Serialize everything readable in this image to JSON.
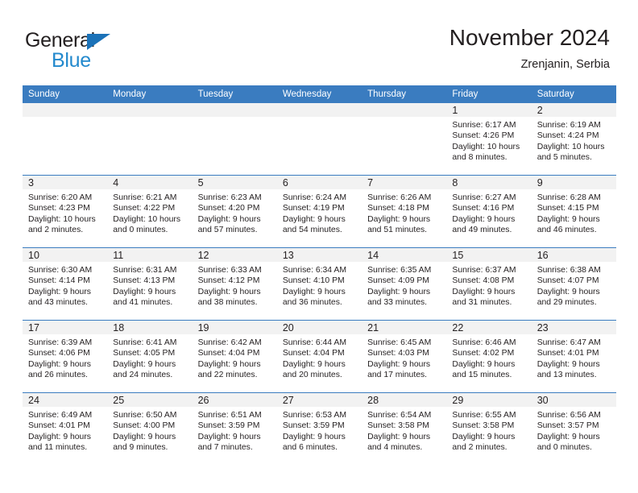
{
  "brand": {
    "name_part1": "General",
    "name_part2": "Blue",
    "triangle_icon": "triangle-icon",
    "color_dark": "#231f20",
    "color_blue": "#2389cd",
    "color_triangle": "#1b72b8"
  },
  "header": {
    "title": "November 2024",
    "subtitle": "Zrenjanin, Serbia"
  },
  "theme": {
    "header_row_bg": "#3a7cc0",
    "daynum_bg": "#f2f2f2",
    "grid_line": "#3a7cc0",
    "text": "#231f20"
  },
  "weekdays": [
    "Sunday",
    "Monday",
    "Tuesday",
    "Wednesday",
    "Thursday",
    "Friday",
    "Saturday"
  ],
  "weeks": [
    [
      {
        "day": "",
        "sunrise": "",
        "sunset": "",
        "daylight_line1": "",
        "daylight_line2": "",
        "empty": true
      },
      {
        "day": "",
        "sunrise": "",
        "sunset": "",
        "daylight_line1": "",
        "daylight_line2": "",
        "empty": true
      },
      {
        "day": "",
        "sunrise": "",
        "sunset": "",
        "daylight_line1": "",
        "daylight_line2": "",
        "empty": true
      },
      {
        "day": "",
        "sunrise": "",
        "sunset": "",
        "daylight_line1": "",
        "daylight_line2": "",
        "empty": true
      },
      {
        "day": "",
        "sunrise": "",
        "sunset": "",
        "daylight_line1": "",
        "daylight_line2": "",
        "empty": true
      },
      {
        "day": "1",
        "sunrise": "Sunrise: 6:17 AM",
        "sunset": "Sunset: 4:26 PM",
        "daylight_line1": "Daylight: 10 hours",
        "daylight_line2": "and 8 minutes.",
        "empty": false
      },
      {
        "day": "2",
        "sunrise": "Sunrise: 6:19 AM",
        "sunset": "Sunset: 4:24 PM",
        "daylight_line1": "Daylight: 10 hours",
        "daylight_line2": "and 5 minutes.",
        "empty": false
      }
    ],
    [
      {
        "day": "3",
        "sunrise": "Sunrise: 6:20 AM",
        "sunset": "Sunset: 4:23 PM",
        "daylight_line1": "Daylight: 10 hours",
        "daylight_line2": "and 2 minutes.",
        "empty": false
      },
      {
        "day": "4",
        "sunrise": "Sunrise: 6:21 AM",
        "sunset": "Sunset: 4:22 PM",
        "daylight_line1": "Daylight: 10 hours",
        "daylight_line2": "and 0 minutes.",
        "empty": false
      },
      {
        "day": "5",
        "sunrise": "Sunrise: 6:23 AM",
        "sunset": "Sunset: 4:20 PM",
        "daylight_line1": "Daylight: 9 hours",
        "daylight_line2": "and 57 minutes.",
        "empty": false
      },
      {
        "day": "6",
        "sunrise": "Sunrise: 6:24 AM",
        "sunset": "Sunset: 4:19 PM",
        "daylight_line1": "Daylight: 9 hours",
        "daylight_line2": "and 54 minutes.",
        "empty": false
      },
      {
        "day": "7",
        "sunrise": "Sunrise: 6:26 AM",
        "sunset": "Sunset: 4:18 PM",
        "daylight_line1": "Daylight: 9 hours",
        "daylight_line2": "and 51 minutes.",
        "empty": false
      },
      {
        "day": "8",
        "sunrise": "Sunrise: 6:27 AM",
        "sunset": "Sunset: 4:16 PM",
        "daylight_line1": "Daylight: 9 hours",
        "daylight_line2": "and 49 minutes.",
        "empty": false
      },
      {
        "day": "9",
        "sunrise": "Sunrise: 6:28 AM",
        "sunset": "Sunset: 4:15 PM",
        "daylight_line1": "Daylight: 9 hours",
        "daylight_line2": "and 46 minutes.",
        "empty": false
      }
    ],
    [
      {
        "day": "10",
        "sunrise": "Sunrise: 6:30 AM",
        "sunset": "Sunset: 4:14 PM",
        "daylight_line1": "Daylight: 9 hours",
        "daylight_line2": "and 43 minutes.",
        "empty": false
      },
      {
        "day": "11",
        "sunrise": "Sunrise: 6:31 AM",
        "sunset": "Sunset: 4:13 PM",
        "daylight_line1": "Daylight: 9 hours",
        "daylight_line2": "and 41 minutes.",
        "empty": false
      },
      {
        "day": "12",
        "sunrise": "Sunrise: 6:33 AM",
        "sunset": "Sunset: 4:12 PM",
        "daylight_line1": "Daylight: 9 hours",
        "daylight_line2": "and 38 minutes.",
        "empty": false
      },
      {
        "day": "13",
        "sunrise": "Sunrise: 6:34 AM",
        "sunset": "Sunset: 4:10 PM",
        "daylight_line1": "Daylight: 9 hours",
        "daylight_line2": "and 36 minutes.",
        "empty": false
      },
      {
        "day": "14",
        "sunrise": "Sunrise: 6:35 AM",
        "sunset": "Sunset: 4:09 PM",
        "daylight_line1": "Daylight: 9 hours",
        "daylight_line2": "and 33 minutes.",
        "empty": false
      },
      {
        "day": "15",
        "sunrise": "Sunrise: 6:37 AM",
        "sunset": "Sunset: 4:08 PM",
        "daylight_line1": "Daylight: 9 hours",
        "daylight_line2": "and 31 minutes.",
        "empty": false
      },
      {
        "day": "16",
        "sunrise": "Sunrise: 6:38 AM",
        "sunset": "Sunset: 4:07 PM",
        "daylight_line1": "Daylight: 9 hours",
        "daylight_line2": "and 29 minutes.",
        "empty": false
      }
    ],
    [
      {
        "day": "17",
        "sunrise": "Sunrise: 6:39 AM",
        "sunset": "Sunset: 4:06 PM",
        "daylight_line1": "Daylight: 9 hours",
        "daylight_line2": "and 26 minutes.",
        "empty": false
      },
      {
        "day": "18",
        "sunrise": "Sunrise: 6:41 AM",
        "sunset": "Sunset: 4:05 PM",
        "daylight_line1": "Daylight: 9 hours",
        "daylight_line2": "and 24 minutes.",
        "empty": false
      },
      {
        "day": "19",
        "sunrise": "Sunrise: 6:42 AM",
        "sunset": "Sunset: 4:04 PM",
        "daylight_line1": "Daylight: 9 hours",
        "daylight_line2": "and 22 minutes.",
        "empty": false
      },
      {
        "day": "20",
        "sunrise": "Sunrise: 6:44 AM",
        "sunset": "Sunset: 4:04 PM",
        "daylight_line1": "Daylight: 9 hours",
        "daylight_line2": "and 20 minutes.",
        "empty": false
      },
      {
        "day": "21",
        "sunrise": "Sunrise: 6:45 AM",
        "sunset": "Sunset: 4:03 PM",
        "daylight_line1": "Daylight: 9 hours",
        "daylight_line2": "and 17 minutes.",
        "empty": false
      },
      {
        "day": "22",
        "sunrise": "Sunrise: 6:46 AM",
        "sunset": "Sunset: 4:02 PM",
        "daylight_line1": "Daylight: 9 hours",
        "daylight_line2": "and 15 minutes.",
        "empty": false
      },
      {
        "day": "23",
        "sunrise": "Sunrise: 6:47 AM",
        "sunset": "Sunset: 4:01 PM",
        "daylight_line1": "Daylight: 9 hours",
        "daylight_line2": "and 13 minutes.",
        "empty": false
      }
    ],
    [
      {
        "day": "24",
        "sunrise": "Sunrise: 6:49 AM",
        "sunset": "Sunset: 4:01 PM",
        "daylight_line1": "Daylight: 9 hours",
        "daylight_line2": "and 11 minutes.",
        "empty": false
      },
      {
        "day": "25",
        "sunrise": "Sunrise: 6:50 AM",
        "sunset": "Sunset: 4:00 PM",
        "daylight_line1": "Daylight: 9 hours",
        "daylight_line2": "and 9 minutes.",
        "empty": false
      },
      {
        "day": "26",
        "sunrise": "Sunrise: 6:51 AM",
        "sunset": "Sunset: 3:59 PM",
        "daylight_line1": "Daylight: 9 hours",
        "daylight_line2": "and 7 minutes.",
        "empty": false
      },
      {
        "day": "27",
        "sunrise": "Sunrise: 6:53 AM",
        "sunset": "Sunset: 3:59 PM",
        "daylight_line1": "Daylight: 9 hours",
        "daylight_line2": "and 6 minutes.",
        "empty": false
      },
      {
        "day": "28",
        "sunrise": "Sunrise: 6:54 AM",
        "sunset": "Sunset: 3:58 PM",
        "daylight_line1": "Daylight: 9 hours",
        "daylight_line2": "and 4 minutes.",
        "empty": false
      },
      {
        "day": "29",
        "sunrise": "Sunrise: 6:55 AM",
        "sunset": "Sunset: 3:58 PM",
        "daylight_line1": "Daylight: 9 hours",
        "daylight_line2": "and 2 minutes.",
        "empty": false
      },
      {
        "day": "30",
        "sunrise": "Sunrise: 6:56 AM",
        "sunset": "Sunset: 3:57 PM",
        "daylight_line1": "Daylight: 9 hours",
        "daylight_line2": "and 0 minutes.",
        "empty": false
      }
    ]
  ]
}
